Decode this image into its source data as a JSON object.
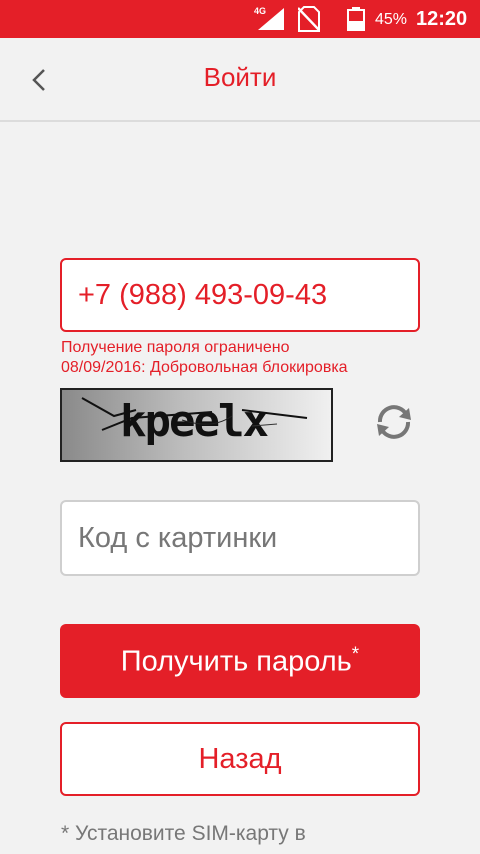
{
  "status_bar": {
    "network": "4G",
    "battery_percent": "45%",
    "battery_level": 0.45,
    "time": "12:20",
    "icons": [
      "signal-icon",
      "no-sim-icon",
      "battery-icon"
    ]
  },
  "header": {
    "title": "Войти",
    "back_icon": "chevron-left-icon"
  },
  "form": {
    "phone_value": "+7 (988) 493-09-43",
    "error_line1": "Получение пароля ограничено",
    "error_line2": "08/09/2016: Добровольная блокировка",
    "captcha_text": "kpeelx",
    "refresh_icon": "refresh-icon",
    "code_placeholder": "Код с картинки",
    "code_value": "",
    "get_password_label": "Получить пароль",
    "get_password_mark": "*",
    "back_label": "Назад",
    "footnote": "* Установите SIM-карту в"
  },
  "colors": {
    "accent": "#e41f28",
    "background": "#f2f2f2",
    "muted_text": "#777777",
    "field_border": "#cfcfcf"
  }
}
